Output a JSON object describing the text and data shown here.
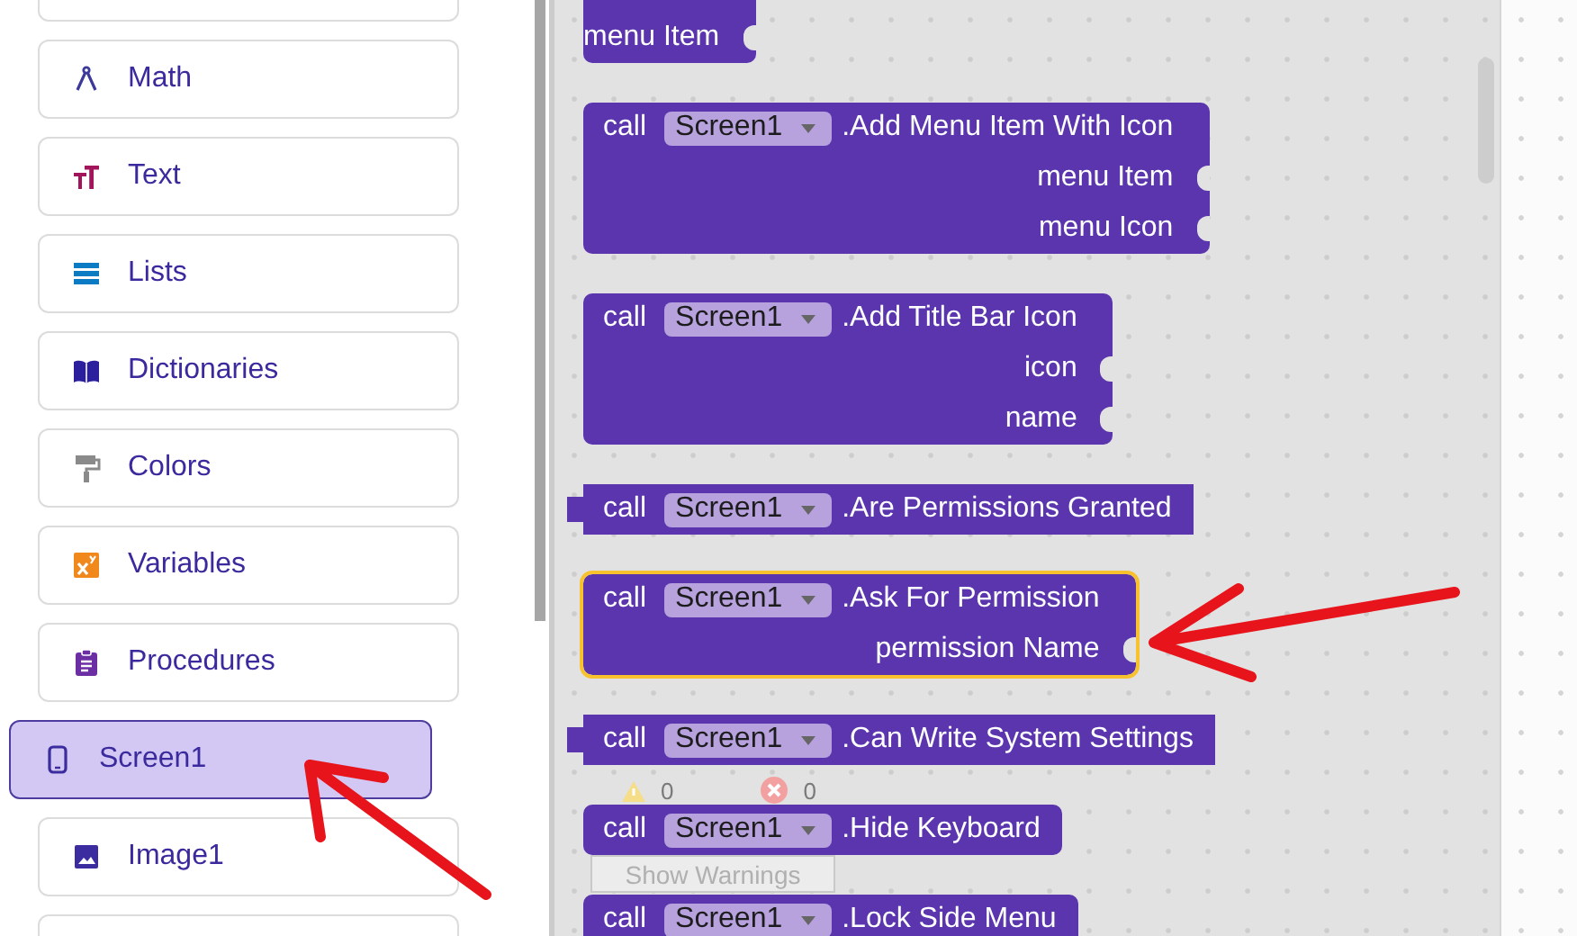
{
  "sidebar": {
    "items": [
      {
        "kind": "clipped",
        "selected": false
      },
      {
        "kind": "category",
        "label": "Math",
        "selected": false
      },
      {
        "kind": "category",
        "label": "Text",
        "selected": false
      },
      {
        "kind": "category",
        "label": "Lists",
        "selected": false
      },
      {
        "kind": "category",
        "label": "Dictionaries",
        "selected": false
      },
      {
        "kind": "category",
        "label": "Colors",
        "selected": false
      },
      {
        "kind": "category",
        "label": "Variables",
        "selected": false
      },
      {
        "kind": "category",
        "label": "Procedures",
        "selected": false
      },
      {
        "kind": "category",
        "label": "Screen1",
        "selected": true
      },
      {
        "kind": "category",
        "label": "Image1",
        "selected": false
      },
      {
        "kind": "clipped",
        "selected": false
      }
    ]
  },
  "blocks": [
    {
      "kind": "statement",
      "inputs": [
        "menu Item"
      ],
      "selected": false
    },
    {
      "kind": "statement",
      "keyword": "call",
      "component": "Screen1",
      "method": ".Add Menu Item With Icon",
      "inputs": [
        "menu Item",
        "menu Icon"
      ],
      "selected": false
    },
    {
      "kind": "statement",
      "keyword": "call",
      "component": "Screen1",
      "method": ".Add Title Bar Icon",
      "inputs": [
        "icon",
        "name"
      ],
      "selected": false
    },
    {
      "kind": "value",
      "keyword": "call",
      "component": "Screen1",
      "method": ".Are Permissions Granted",
      "selected": false
    },
    {
      "kind": "statement",
      "keyword": "call",
      "component": "Screen1",
      "method": ".Ask For Permission",
      "inputs": [
        "permission Name"
      ],
      "selected": true
    },
    {
      "kind": "value",
      "keyword": "call",
      "component": "Screen1",
      "method": ".Can Write System Settings",
      "selected": false
    },
    {
      "kind": "statement",
      "keyword": "call",
      "component": "Screen1",
      "method": ".Hide Keyboard",
      "selected": false
    },
    {
      "kind": "statement",
      "keyword": "call",
      "component": "Screen1",
      "method": ".Lock Side Menu",
      "selected": false
    }
  ],
  "warnings": {
    "warning_count": "0",
    "error_count": "0",
    "button": "Show Warnings"
  },
  "annotations": [
    {
      "kind": "arrow"
    },
    {
      "kind": "arrow"
    }
  ]
}
